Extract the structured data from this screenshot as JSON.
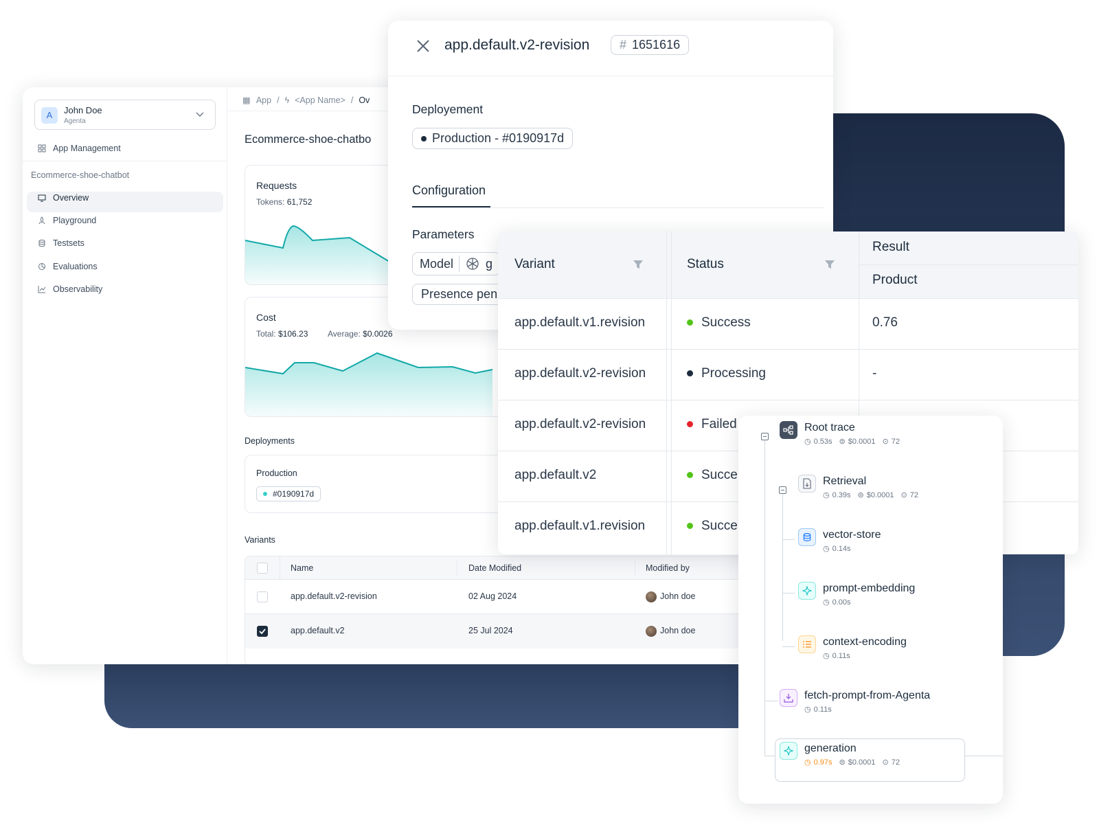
{
  "sidebar": {
    "user_name": "John Doe",
    "user_org": "Agenta",
    "avatar_letter": "A",
    "app_management": "App Management",
    "section_title": "Ecommerce-shoe-chatbot",
    "items": [
      {
        "label": "Overview",
        "icon": "monitor-icon",
        "active": true
      },
      {
        "label": "Playground",
        "icon": "rocket-icon"
      },
      {
        "label": "Testsets",
        "icon": "database-icon"
      },
      {
        "label": "Evaluations",
        "icon": "chart-pie-icon"
      },
      {
        "label": "Observability",
        "icon": "line-chart-icon"
      }
    ]
  },
  "breadcrumb": {
    "app": "App",
    "sep1": "/",
    "app_name": "<App Name>",
    "sep2": "/",
    "current": "Ov"
  },
  "page_title": "Ecommerce-shoe-chatbo",
  "requests": {
    "title": "Requests",
    "tokens_label": "Tokens:",
    "tokens_value": "61,752"
  },
  "cost": {
    "title": "Cost",
    "total_label": "Total:",
    "total_value": "$106.23",
    "avg_label": "Average:",
    "avg_value": "$0.0026"
  },
  "deployments": {
    "title": "Deployments",
    "env": "Production",
    "hash": "#0190917d"
  },
  "variants": {
    "title": "Variants",
    "headers": [
      "Name",
      "Date Modified",
      "Modified by"
    ],
    "rows": [
      {
        "name": "app.default.v2-revision",
        "date": "02 Aug 2024",
        "by": "John doe",
        "checked": false
      },
      {
        "name": "app.default.v2",
        "date": "25 Jul 2024",
        "by": "John doe",
        "checked": true
      }
    ]
  },
  "modal": {
    "title": "app.default.v2-revision",
    "id_hash": "#",
    "id_value": "1651616",
    "deployment_label": "Deployement",
    "deployment_tag": "Production - #0190917d",
    "tab": "Configuration",
    "params_label": "Parameters",
    "model_label": "Model",
    "model_value_partial": "g",
    "presence_label": "Presence pen"
  },
  "results": {
    "headers": {
      "variant": "Variant",
      "status": "Status",
      "result": "Result",
      "product": "Product"
    },
    "rows": [
      {
        "variant": "app.default.v1.revision",
        "status": "Success",
        "color": "#52c41a",
        "result": "0.76"
      },
      {
        "variant": "app.default.v2-revision",
        "status": "Processing",
        "color": "#1c2c3d",
        "result": "-"
      },
      {
        "variant": "app.default.v2-revision",
        "status": "Failed",
        "color": "#e5242b",
        "result": ""
      },
      {
        "variant": "app.default.v2",
        "status": "Succe",
        "color": "#52c41a",
        "result": ""
      },
      {
        "variant": "app.default.v1.revision",
        "status": "Succe",
        "color": "#52c41a",
        "result": ""
      }
    ]
  },
  "trace": {
    "nodes": [
      {
        "title": "Root trace",
        "time": "0.53s",
        "cost": "$0.0001",
        "tokens": "72",
        "icon": "tree-icon"
      },
      {
        "title": "Retrieval",
        "time": "0.39s",
        "cost": "$0.0001",
        "tokens": "72",
        "icon": "file-icon"
      },
      {
        "title": "vector-store",
        "time": "0.14s",
        "icon": "database-icon"
      },
      {
        "title": "prompt-embedding",
        "time": "0.00s",
        "icon": "sparkle-icon"
      },
      {
        "title": "context-encoding",
        "time": "0.11s",
        "icon": "list-icon"
      },
      {
        "title": "fetch-prompt-from-Agenta",
        "time": "0.11s",
        "icon": "download-icon"
      },
      {
        "title": "generation",
        "time": "0.97s",
        "cost": "$0.0001",
        "tokens": "72",
        "icon": "sparkle-icon"
      }
    ]
  }
}
